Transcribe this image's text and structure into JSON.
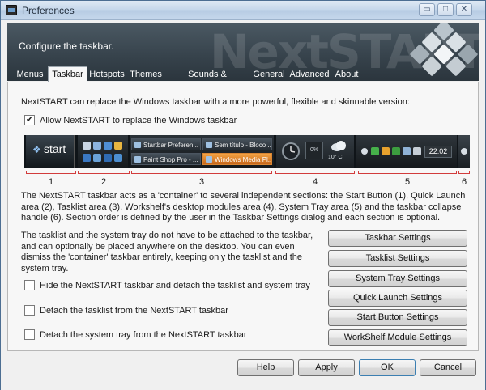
{
  "window": {
    "title": "Preferences",
    "minimize_glyph": "▭",
    "maximize_glyph": "□",
    "close_glyph": "✕"
  },
  "banner": {
    "brand": "NextSTART",
    "subtitle": "Configure the taskbar."
  },
  "tabs": [
    {
      "label": "Menus",
      "active": false
    },
    {
      "label": "Taskbar",
      "active": true
    },
    {
      "label": "Hotspots",
      "active": false
    },
    {
      "label": "Themes",
      "active": false
    },
    {
      "label": "Sounds & Animations",
      "active": false
    },
    {
      "label": "General",
      "active": false
    },
    {
      "label": "Advanced",
      "active": false
    },
    {
      "label": "About",
      "active": false
    }
  ],
  "taskbar_page": {
    "intro": "NextSTART can replace the Windows taskbar with a more powerful, flexible and skinnable version:",
    "allow_replace": {
      "label": "Allow NextSTART to replace the Windows taskbar",
      "checked": true,
      "mark": "✔"
    },
    "preview": {
      "start_label": "start",
      "start_orb": "❖",
      "tasks": [
        "Startbar Preferen...",
        "Sem título - Bloco ...",
        "Paint Shop Pro - ...",
        "Windows Media Pl..."
      ],
      "active_task": "Windows Media Pl...",
      "ws_temp": "10° C",
      "ws_cpu": "0%",
      "clock": "22:02",
      "section_numbers": [
        "1",
        "2",
        "3",
        "4",
        "5",
        "6"
      ]
    },
    "description": "The NextSTART taskbar acts as a 'container' to several independent sections: the Start Button (1), Quick Launch area (2), Tasklist area (3), Workshelf's desktop modules area (4), System Tray area (5) and the taskbar collapse handle (6). Section order is defined by the user in the Taskbar Settings dialog and each section is optional.",
    "detach_text": "The tasklist and the system tray do not have to be attached to the taskbar, and can optionally be placed anywhere on the desktop. You can even dismiss the 'container' taskbar entirely, keeping only the tasklist and the system tray.",
    "options": [
      {
        "label": "Hide the NextSTART taskbar and detach the tasklist and system tray",
        "checked": false
      },
      {
        "label": "Detach the tasklist from the NextSTART taskbar",
        "checked": false
      },
      {
        "label": "Detach the system tray from the NextSTART taskbar",
        "checked": false
      }
    ],
    "settings_buttons": [
      "Taskbar Settings",
      "Tasklist Settings",
      "System Tray Settings",
      "Quick Launch Settings",
      "Start Button Settings",
      "WorkShelf Module Settings"
    ]
  },
  "footer": {
    "help": "Help",
    "apply": "Apply",
    "ok": "OK",
    "cancel": "Cancel"
  }
}
